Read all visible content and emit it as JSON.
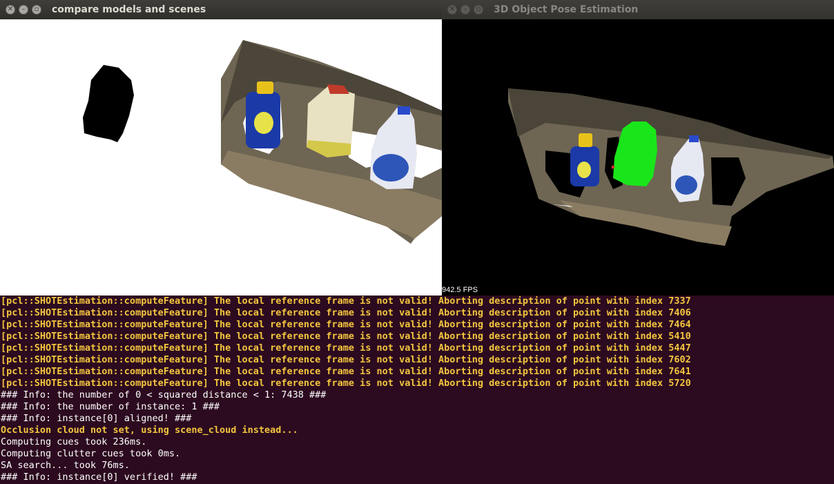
{
  "left_window": {
    "title": "compare models and scenes",
    "controls": [
      "close-icon",
      "minimize-icon",
      "maximize-icon"
    ]
  },
  "right_window": {
    "title": "3D Object Pose Estimation",
    "controls": [
      "close-icon",
      "minimize-icon",
      "maximize-icon"
    ],
    "fps": "942.5 FPS"
  },
  "terminal": {
    "lines": [
      {
        "text": "[pcl::SHOTEstimation::computeFeature] The local reference frame is not valid! Aborting description of point with index 7337",
        "type": "warn"
      },
      {
        "text": "[pcl::SHOTEstimation::computeFeature] The local reference frame is not valid! Aborting description of point with index 7406",
        "type": "warn"
      },
      {
        "text": "[pcl::SHOTEstimation::computeFeature] The local reference frame is not valid! Aborting description of point with index 7464",
        "type": "warn"
      },
      {
        "text": "[pcl::SHOTEstimation::computeFeature] The local reference frame is not valid! Aborting description of point with index 5410",
        "type": "warn"
      },
      {
        "text": "[pcl::SHOTEstimation::computeFeature] The local reference frame is not valid! Aborting description of point with index 5447",
        "type": "warn"
      },
      {
        "text": "[pcl::SHOTEstimation::computeFeature] The local reference frame is not valid! Aborting description of point with index 7602",
        "type": "warn"
      },
      {
        "text": "[pcl::SHOTEstimation::computeFeature] The local reference frame is not valid! Aborting description of point with index 7641",
        "type": "warn"
      },
      {
        "text": "[pcl::SHOTEstimation::computeFeature] The local reference frame is not valid! Aborting description of point with index 5720",
        "type": "warn"
      },
      {
        "text": "### Info: the number of 0 < squared distance < 1: 7438 ###",
        "type": "info"
      },
      {
        "text": "### Info: the number of instance: 1 ###",
        "type": "info"
      },
      {
        "text": "### Info: instance[0] aligned! ###",
        "type": "info"
      },
      {
        "text": "Occlusion cloud not set, using scene_cloud instead...",
        "type": "warn"
      },
      {
        "text": "Computing cues took 236ms.",
        "type": "info"
      },
      {
        "text": "Computing clutter cues took 0ms.",
        "type": "info"
      },
      {
        "text": "SA search... took 76ms.",
        "type": "info"
      },
      {
        "text": "### Info: instance[0] verified! ###",
        "type": "info"
      }
    ]
  },
  "colors": {
    "terminal_bg": "#2c0a1f",
    "warning_text": "#f4c63f",
    "normal_text": "#ffffff",
    "highlight_model": "#19e61a",
    "table_surface": "#6e6553"
  }
}
